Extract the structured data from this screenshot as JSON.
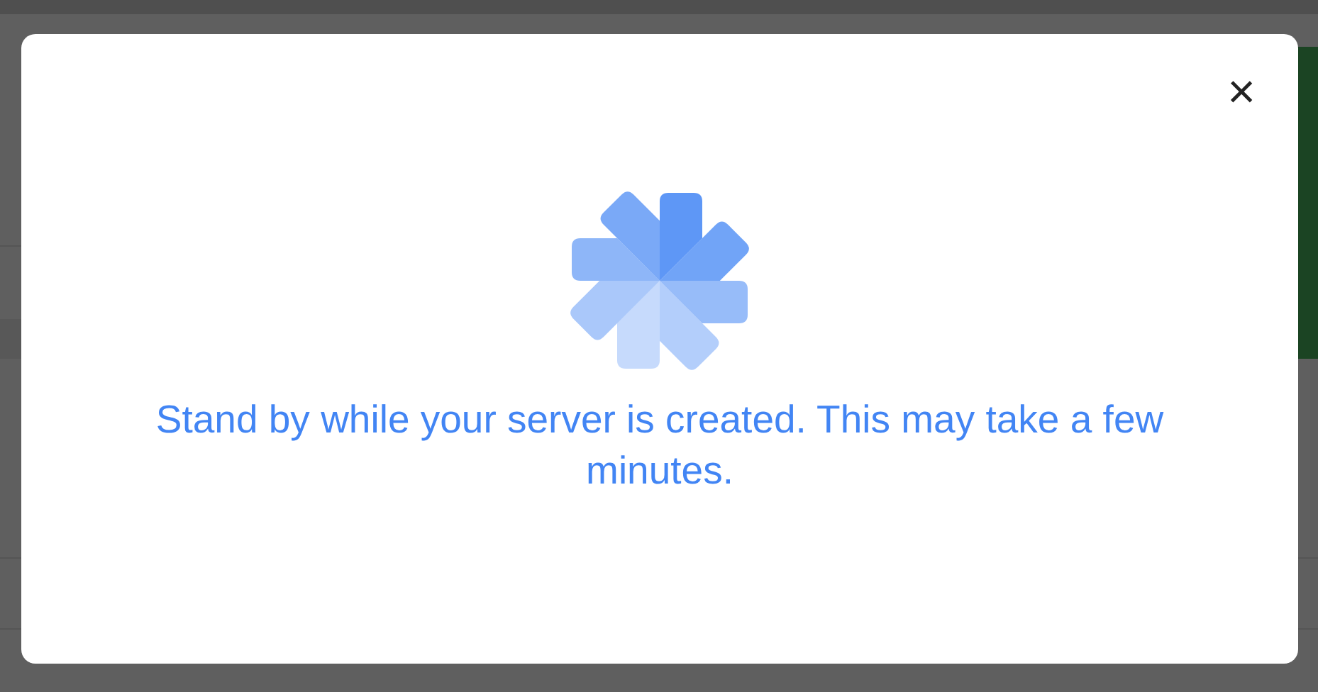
{
  "dialog": {
    "close": "×",
    "message": "Stand by while your server is created. This may take a few minutes."
  }
}
